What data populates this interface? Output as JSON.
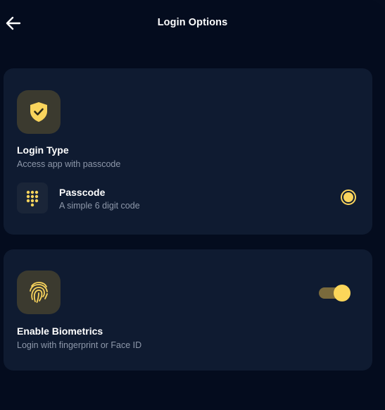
{
  "header": {
    "title": "Login Options",
    "back_icon": "arrow-left-icon"
  },
  "login_type_card": {
    "icon": "shield-check-icon",
    "heading": "Login Type",
    "subtitle": "Access app with passcode",
    "option": {
      "icon": "keypad-icon",
      "label": "Passcode",
      "description": "A simple 6 digit code",
      "selected": true
    }
  },
  "biometrics_card": {
    "icon": "fingerprint-icon",
    "heading": "Enable Biometrics",
    "subtitle": "Login with fingerprint or Face ID",
    "enabled": true
  },
  "colors": {
    "accent": "#f9d45c",
    "background": "#040c1e",
    "card": "#0f1b31",
    "muted_text": "#8e98aa"
  }
}
